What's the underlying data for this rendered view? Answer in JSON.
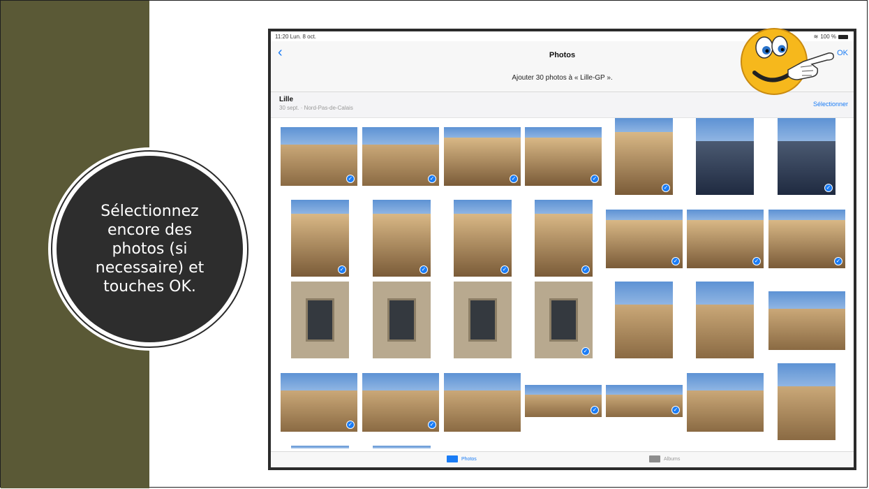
{
  "slide": {
    "instruction": "Sélectionnez\nencore  des\nphotos (si\nnecessaire) et\ntouches OK."
  },
  "ipad": {
    "status": {
      "time": "11:20",
      "date": "Lun. 8 oct.",
      "battery": "100 %"
    },
    "nav": {
      "back_icon": "chevron-left",
      "title": "Photos",
      "ok_label": "OK",
      "subtitle": "Ajouter 30 photos à « Lille-GP »."
    },
    "section": {
      "title": "Lille",
      "subtitle": "30 sept. · Nord-Pas-de-Calais",
      "select_label": "Sélectionner"
    },
    "tabs": [
      {
        "label": "Photos",
        "icon": "photos-icon",
        "active": true
      },
      {
        "label": "Albums",
        "icon": "albums-icon",
        "active": false
      }
    ],
    "selected_check_icon": "checkmark",
    "colors": {
      "accent": "#1a7cf5",
      "slide_bar": "#5a5936",
      "circle": "#2d2d2d"
    }
  },
  "decoration": {
    "pointing_smiley": "smiley-pointing-icon"
  }
}
